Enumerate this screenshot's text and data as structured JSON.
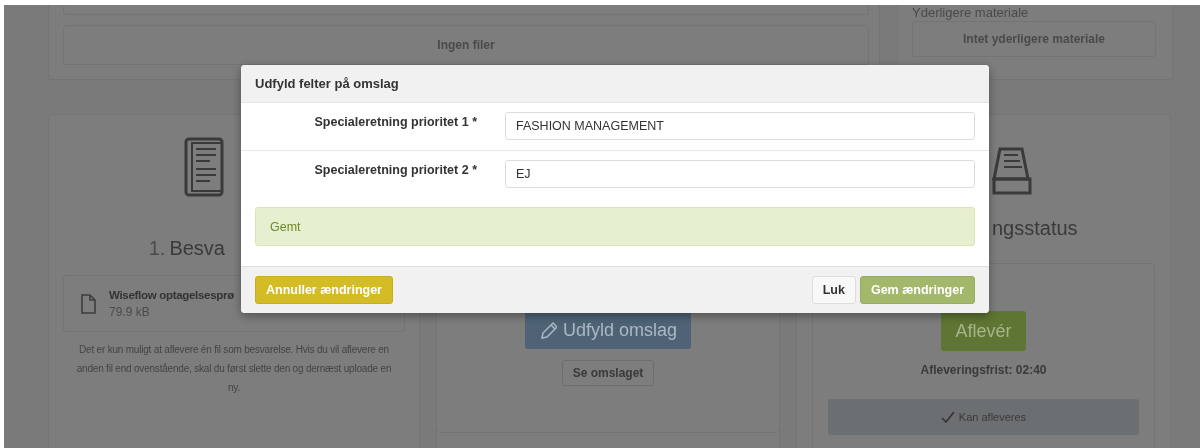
{
  "background": {
    "files_box": {
      "empty_text": "Ingen filer"
    },
    "material": {
      "heading": "Yderligere materiale",
      "empty_text": "Intet yderligere materiale"
    },
    "answer_card": {
      "number": "1.",
      "title": "Besva",
      "file": {
        "name": "Wiseflow optagelsesprø",
        "size": "79.9 kB"
      },
      "note": "Det er kun muligt at aflevere én fil som besvarelse. Hvis du vil aflevere en anden fil end ovenstående, skal du først slette den og dernæst uploade en ny."
    },
    "cover_card": {
      "fill_button": "Udfyld omslag",
      "view_button": "Se omslaget"
    },
    "status_card": {
      "title": "ngsstatus",
      "submit_button": "Aflevér",
      "deadline": "Afleveringsfrist: 02:40",
      "status": "Kan afleveres"
    }
  },
  "modal": {
    "title": "Udfyld felter på omslag",
    "fields": [
      {
        "label": "Specialeretning prioritet 1 *",
        "value": "FASHION MANAGEMENT"
      },
      {
        "label": "Specialeretning prioritet 2 *",
        "value": "EJ"
      }
    ],
    "alert": "Gemt",
    "buttons": [
      {
        "label": "Annuller ændringer",
        "kind": "warning"
      },
      {
        "label": "Luk",
        "kind": "default"
      },
      {
        "label": "Gem ændringer",
        "kind": "success"
      }
    ]
  }
}
